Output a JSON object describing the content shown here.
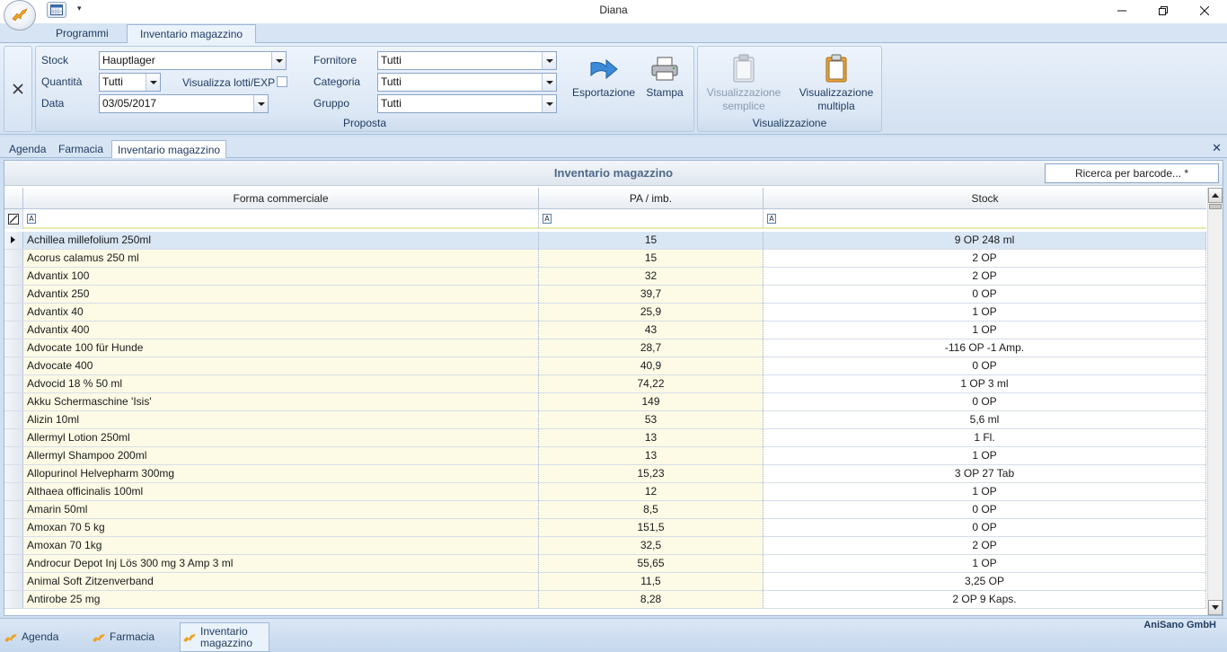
{
  "window": {
    "title": "Diana"
  },
  "icons": {
    "app": "horse-logo-icon",
    "calendar": "calendar-icon",
    "export": "arrow-right-icon",
    "print": "printer-icon",
    "clipboard": "clipboard-icon"
  },
  "colors": {
    "ribbon": "#d6e4f3",
    "row_highlight": "#fdfbe6",
    "selected_row": "#d9e6f4",
    "accent": "#1e3a5f"
  },
  "ribbon": {
    "tabs": [
      "Programmi",
      "Inventario magazzino"
    ],
    "active_tab": "Inventario magazzino",
    "stock_label": "Stock",
    "stock_value": "Hauptlager",
    "quantita_label": "Quantità",
    "quantita_value": "Tutti",
    "lotti_label": "Visualizza lotti/EXP",
    "data_label": "Data",
    "data_value": "03/05/2017",
    "fornitore_label": "Fornitore",
    "fornitore_value": "Tutti",
    "categoria_label": "Categoria",
    "categoria_value": "Tutti",
    "gruppo_label": "Gruppo",
    "gruppo_value": "Tutti",
    "proposta_group": "Proposta",
    "esportazione": "Esportazione",
    "stampa": "Stampa",
    "vis_semplice_1": "Visualizzazione",
    "vis_semplice_2": "semplice",
    "vis_multipla_1": "Visualizzazione",
    "vis_multipla_2": "multipla",
    "visualizzazione_group": "Visualizzazione"
  },
  "doc_tabs": [
    "Agenda",
    "Farmacia",
    "Inventario magazzino"
  ],
  "panel": {
    "title": "Inventario magazzino",
    "barcode_search": "Ricerca per barcode... *"
  },
  "grid": {
    "columns": [
      "Forma commerciale",
      "PA / imb.",
      "Stock"
    ],
    "rows": [
      [
        "Achillea millefolium 250ml",
        "15",
        "9 OP 248 ml"
      ],
      [
        "Acorus calamus 250 ml",
        "15",
        "2 OP"
      ],
      [
        "Advantix 100",
        "32",
        "2 OP"
      ],
      [
        "Advantix 250",
        "39,7",
        "0 OP"
      ],
      [
        "Advantix 40",
        "25,9",
        "1 OP"
      ],
      [
        "Advantix 400",
        "43",
        "1 OP"
      ],
      [
        "Advocate 100 für Hunde",
        "28,7",
        "-116 OP -1 Amp."
      ],
      [
        "Advocate 400",
        "40,9",
        "0 OP"
      ],
      [
        "Advocid 18 % 50 ml",
        "74,22",
        "1 OP 3 ml"
      ],
      [
        "Akku Schermaschine 'Isis'",
        "149",
        "0 OP"
      ],
      [
        "Alizin 10ml",
        "53",
        "5,6 ml"
      ],
      [
        "Allermyl Lotion  250ml",
        "13",
        "1 Fl."
      ],
      [
        "Allermyl Shampoo 200ml",
        "13",
        "1 OP"
      ],
      [
        "Allopurinol Helvepharm 300mg",
        "15,23",
        "3 OP 27 Tab"
      ],
      [
        "Althaea officinalis 100ml",
        "12",
        "1 OP"
      ],
      [
        "Amarin 50ml",
        "8,5",
        "0 OP"
      ],
      [
        "Amoxan 70   5 kg",
        "151,5",
        "0 OP"
      ],
      [
        "Amoxan 70  1kg",
        "32,5",
        "2 OP"
      ],
      [
        "Androcur Depot Inj Lös 300 mg 3 Amp 3 ml",
        "55,65",
        "1 OP"
      ],
      [
        "Animal Soft Zitzenverband",
        "11,5",
        "3,25 OP"
      ],
      [
        "Antirobe 25 mg",
        "8,28",
        "2 OP 9 Kaps."
      ]
    ]
  },
  "bottom": {
    "company": "AniSano GmbH",
    "tabs": [
      "Agenda",
      "Farmacia",
      "Inventario",
      "magazzino"
    ]
  }
}
